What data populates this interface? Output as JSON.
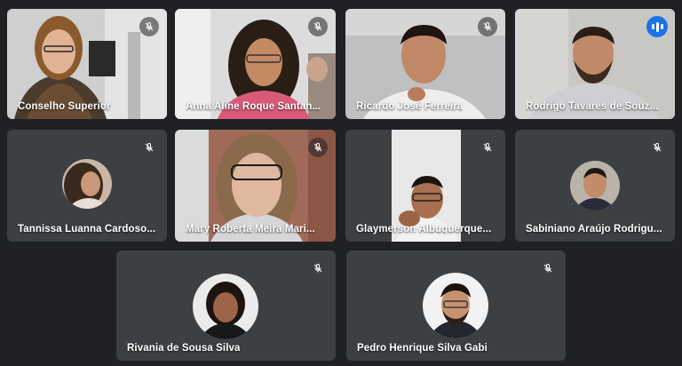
{
  "participants": [
    {
      "name": "Conselho Superior",
      "muted": true,
      "speaking": false
    },
    {
      "name": "Anna Aline Roque Santan...",
      "muted": true,
      "speaking": false
    },
    {
      "name": "Ricardo José Ferreira",
      "muted": true,
      "speaking": false
    },
    {
      "name": "Rodrigo Tavares de Souz...",
      "muted": false,
      "speaking": true
    },
    {
      "name": "Tannissa Luanna Cardoso...",
      "muted": true,
      "speaking": false
    },
    {
      "name": "Mary Roberta Meira Mari...",
      "muted": true,
      "speaking": false
    },
    {
      "name": "Glaymerson Albuquerque...",
      "muted": true,
      "speaking": false
    },
    {
      "name": "Sabiniano Araújo Rodrigu...",
      "muted": true,
      "speaking": false
    },
    {
      "name": "Rivania de Sousa Silva",
      "muted": true,
      "speaking": false
    },
    {
      "name": "Pedro Henrique Silva Gabi",
      "muted": true,
      "speaking": false
    }
  ],
  "icons": {
    "mic_off": "mic-off-icon",
    "speaking": "speaking-indicator-icon"
  },
  "colors": {
    "background": "#202124",
    "tile": "#3c4043",
    "speaking_outline": "#8ab4f8",
    "speaking_badge": "#1a73e8"
  }
}
